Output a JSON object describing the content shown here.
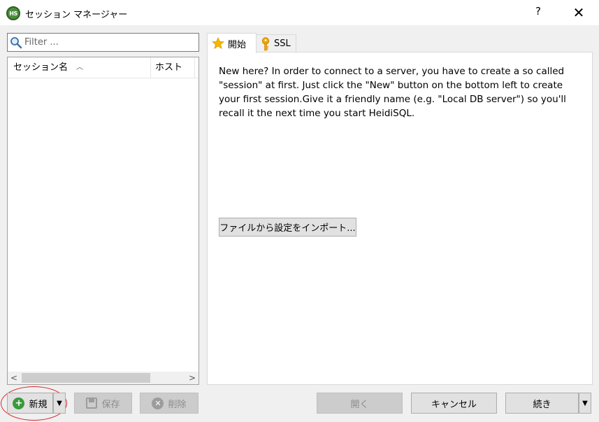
{
  "window": {
    "app_icon_text": "HS",
    "title": "セッション マネージャー",
    "help_glyph": "?",
    "close_glyph": "✕"
  },
  "filter": {
    "placeholder": "Filter ..."
  },
  "session_list": {
    "columns": [
      {
        "label": "セッション名",
        "sort": "ascending"
      },
      {
        "label": "ホスト"
      }
    ],
    "rows": [],
    "scroll_left_glyph": "<",
    "scroll_right_glyph": ">"
  },
  "tabs": [
    {
      "label": "開始",
      "icon": "star-icon",
      "active": true
    },
    {
      "label": "SSL",
      "icon": "key-icon",
      "active": false
    }
  ],
  "start_panel": {
    "welcome_text": "New here? In order to connect to a server, you have to create a so called \"session\" at first. Just click the \"New\" button on the bottom left to create your first session.Give it a friendly name (e.g. \"Local DB server\") so you'll recall it the next time you start HeidiSQL.",
    "import_button": "ファイルから設定をインポート..."
  },
  "buttons": {
    "new": "新規",
    "save": "保存",
    "delete": "削除",
    "open": "開く",
    "cancel": "キャンセル",
    "continue": "続き"
  },
  "colors": {
    "highlight_ellipse": "#d62828",
    "new_icon": "#3a9a3a",
    "star": "#f5b800",
    "key": "#f0a500"
  }
}
